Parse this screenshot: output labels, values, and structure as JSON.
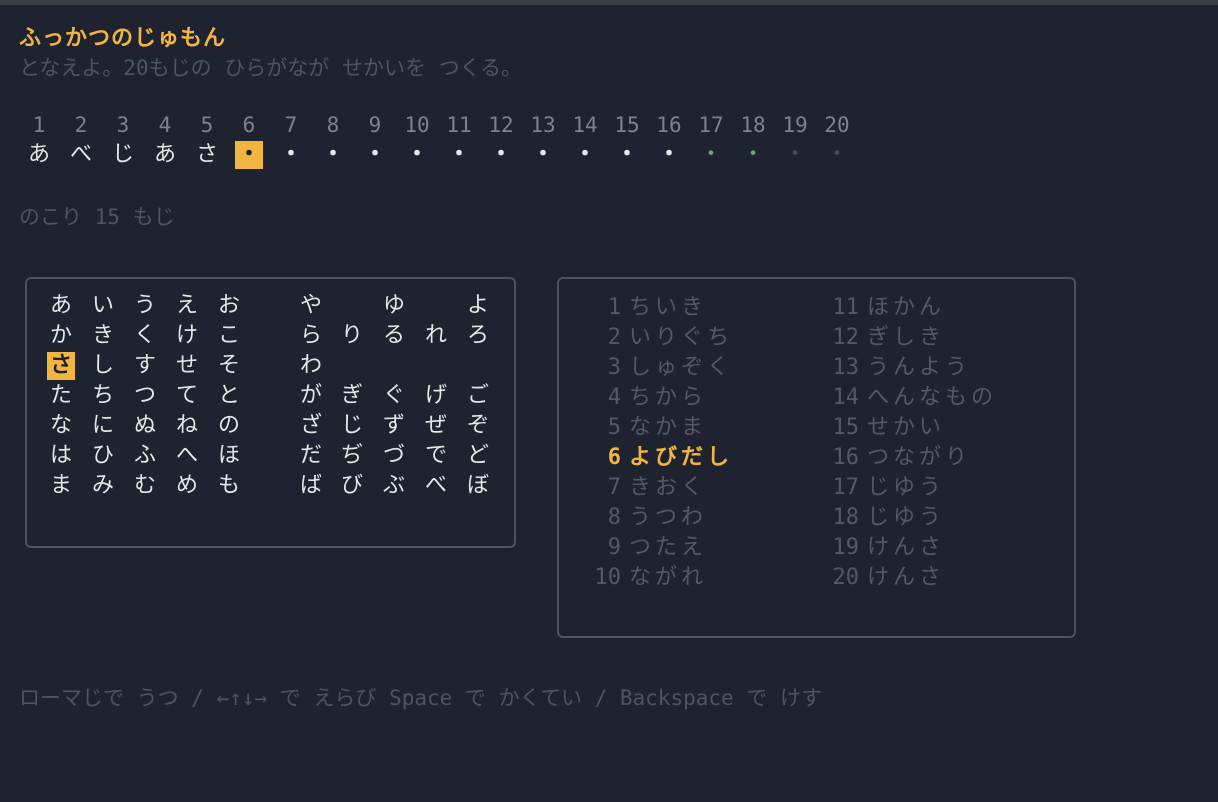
{
  "title": "ふっかつのじゅもん",
  "subtitle": "となえよ。20もじの ひらがなが せかいを つくる。",
  "slots": {
    "numbers": [
      "1",
      "2",
      "3",
      "4",
      "5",
      "6",
      "7",
      "8",
      "9",
      "10",
      "11",
      "12",
      "13",
      "14",
      "15",
      "16",
      "17",
      "18",
      "19",
      "20"
    ],
    "chars": [
      "あ",
      "べ",
      "じ",
      "あ",
      "さ",
      "・",
      "・",
      "・",
      "・",
      "・",
      "・",
      "・",
      "・",
      "・",
      "・",
      "・",
      "・",
      "・",
      "・",
      "・"
    ],
    "states": [
      "filled",
      "filled",
      "filled",
      "filled",
      "filled",
      "cursor",
      "empty",
      "empty",
      "empty",
      "empty",
      "empty",
      "empty",
      "empty",
      "empty",
      "empty",
      "empty",
      "green",
      "green",
      "dim",
      "dim"
    ]
  },
  "remaining": "のこり 15 もじ",
  "kana_grid": {
    "rows": [
      [
        "あ",
        "い",
        "う",
        "え",
        "お",
        "",
        "や",
        "",
        "ゆ",
        "",
        "よ"
      ],
      [
        "か",
        "き",
        "く",
        "け",
        "こ",
        "",
        "ら",
        "り",
        "る",
        "れ",
        "ろ"
      ],
      [
        "さ",
        "し",
        "す",
        "せ",
        "そ",
        "",
        "わ",
        "",
        "",
        "",
        ""
      ],
      [
        "た",
        "ち",
        "つ",
        "て",
        "と",
        "",
        "が",
        "ぎ",
        "ぐ",
        "げ",
        "ご"
      ],
      [
        "な",
        "に",
        "ぬ",
        "ね",
        "の",
        "",
        "ざ",
        "じ",
        "ず",
        "ぜ",
        "ぞ"
      ],
      [
        "は",
        "ひ",
        "ふ",
        "へ",
        "ほ",
        "",
        "だ",
        "ぢ",
        "づ",
        "で",
        "ど"
      ],
      [
        "ま",
        "み",
        "む",
        "め",
        "も",
        "",
        "ば",
        "び",
        "ぶ",
        "べ",
        "ぼ"
      ]
    ],
    "selected": "さ"
  },
  "word_list": [
    {
      "num": "1",
      "word": "ちいき"
    },
    {
      "num": "2",
      "word": "いりぐち"
    },
    {
      "num": "3",
      "word": "しゅぞく"
    },
    {
      "num": "4",
      "word": "ちから"
    },
    {
      "num": "5",
      "word": "なかま"
    },
    {
      "num": "6",
      "word": "よびだし"
    },
    {
      "num": "7",
      "word": "きおく"
    },
    {
      "num": "8",
      "word": "うつわ"
    },
    {
      "num": "9",
      "word": "つたえ"
    },
    {
      "num": "10",
      "word": "ながれ"
    },
    {
      "num": "11",
      "word": "ほかん"
    },
    {
      "num": "12",
      "word": "ぎしき"
    },
    {
      "num": "13",
      "word": "うんよう"
    },
    {
      "num": "14",
      "word": "へんなもの"
    },
    {
      "num": "15",
      "word": "せかい"
    },
    {
      "num": "16",
      "word": "つながり"
    },
    {
      "num": "17",
      "word": "じゆう"
    },
    {
      "num": "18",
      "word": "じゆう"
    },
    {
      "num": "19",
      "word": "けんさ"
    },
    {
      "num": "20",
      "word": "けんさ"
    }
  ],
  "active_word": "6",
  "help_text": "ローマじで うつ / ←↑↓→ で えらび Space で かくてい / Backspace で けす",
  "colors": {
    "accent": "#f2b640",
    "background": "#1f2330",
    "dim_text": "#4e5462",
    "green_slot": "#6aa86a"
  }
}
